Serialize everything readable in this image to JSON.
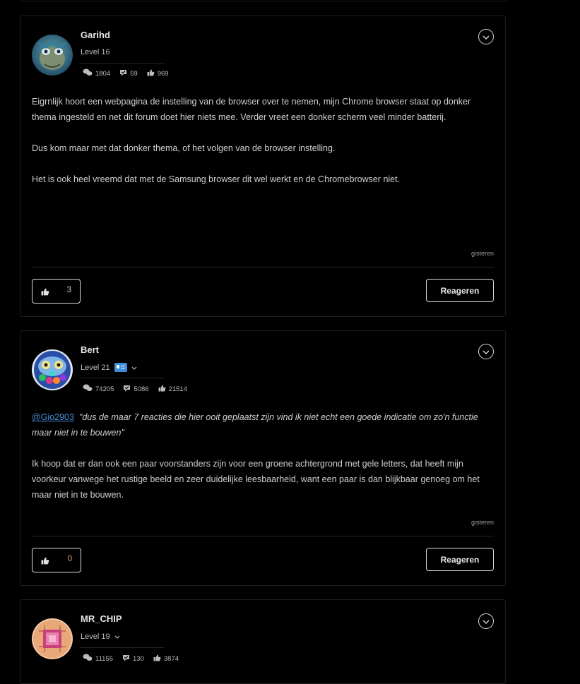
{
  "posts": [
    {
      "username": "Garihd",
      "level": "Level 16",
      "stats": {
        "posts": "1804",
        "solutions": "59",
        "likes": "969"
      },
      "paragraphs": [
        "Eigrnlijk hoort een webpagina de instelling van de browser over te nemen, mijn Chrome browser staat op donker thema ingesteld en net dit forum doet hier niets mee. Verder vreet een donker scherm veel minder batterij.",
        "Dus kom maar met dat donker thema, of het volgen van de browser instelling.",
        "Het is ook heel vreemd dat met de Samsung browser dit wel werkt en de Chromebrowser niet."
      ],
      "timestamp": "gisteren",
      "like_count": "3",
      "reply_label": "Reageren"
    },
    {
      "username": "Bert",
      "level": "Level 21",
      "stats": {
        "posts": "74205",
        "solutions": "5086",
        "likes": "21514"
      },
      "mention": "@Gio2903",
      "quote": "\"dus de maar 7 reacties die hier ooit geplaatst zijn vind ik niet echt een goede indicatie om zo'n functie maar niet in te bouwen\"",
      "paragraphs": [
        "Ik hoop dat er dan ook een paar voorstanders zijn voor een groene achtergrond met gele letters, dat heeft mijn voorkeur vanwege het rustige beeld en zeer duidelijke leesbaarheid, want een paar is dan blijkbaar genoeg om het maar niet in te bouwen."
      ],
      "timestamp": "gisteren",
      "like_count": "0",
      "reply_label": "Reageren"
    },
    {
      "username": "MR_CHIP",
      "level": "Level 19",
      "stats": {
        "posts": "11155",
        "solutions": "130",
        "likes": "3874"
      }
    }
  ],
  "colors": {
    "background": "#000000",
    "border": "#1f1f1f",
    "link": "#4a8fd8",
    "badge": "#3d8fdc"
  }
}
